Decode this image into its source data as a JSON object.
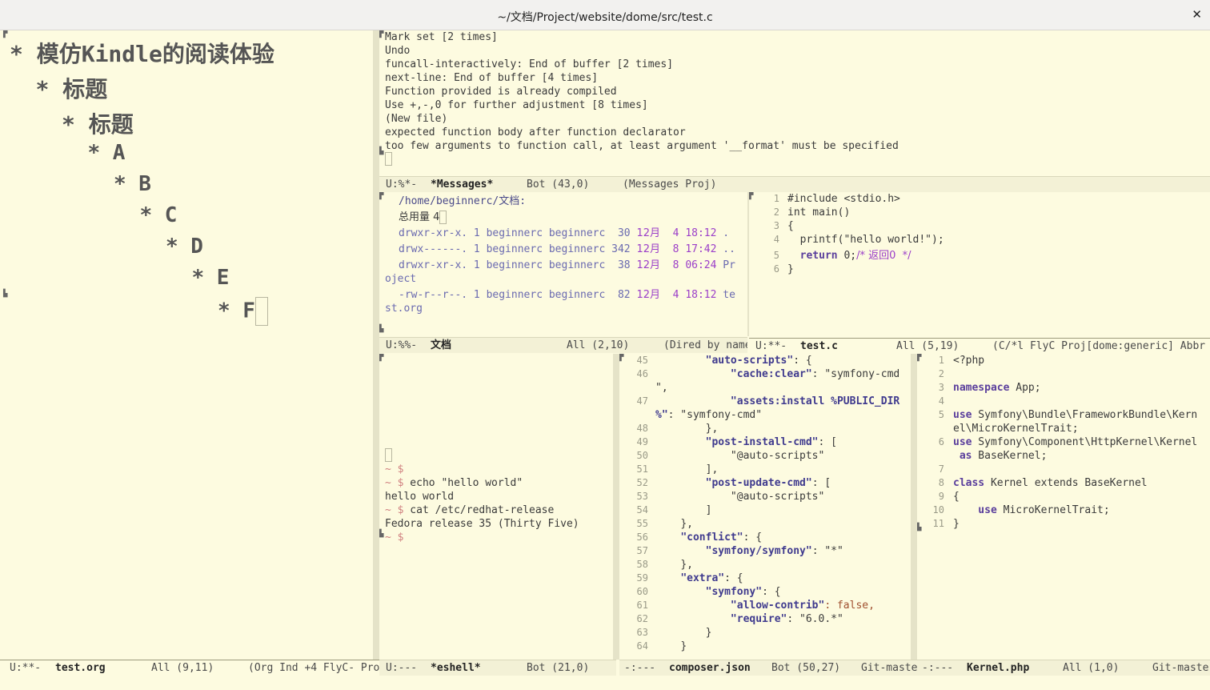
{
  "window": {
    "title": "~/文档/Project/website/dome/src/test.c",
    "close": "✕"
  },
  "org": {
    "headings": [
      {
        "text": "* 模仿Kindle的阅读体验",
        "level": 1
      },
      {
        "text": "* 标题",
        "level": 2
      },
      {
        "text": "* 标题",
        "level": 3
      },
      {
        "text": "* A",
        "level": 4
      },
      {
        "text": "* B",
        "level": 5
      },
      {
        "text": "* C",
        "level": 6
      },
      {
        "text": "* D",
        "level": 7
      },
      {
        "text": "* E",
        "level": 8
      },
      {
        "text": "* F",
        "level": 9
      }
    ],
    "modeline": {
      "state": "U:**-",
      "buffer": "test.org",
      "pos": "All (9,11)",
      "modes": "(Org Ind +4 FlyC- Pro"
    }
  },
  "messages": {
    "lines": [
      "Mark set [2 times]",
      "Undo",
      "funcall-interactively: End of buffer [2 times]",
      "next-line: End of buffer [4 times]",
      "Function provided is already compiled",
      "Use +,-,0 for further adjustment [8 times]",
      "(New file)",
      "expected function body after function declarator",
      "too few arguments to function call, at least argument '__format' must be specified"
    ],
    "modeline": {
      "state": "U:%*-",
      "buffer": "*Messages*",
      "pos": "Bot (43,0)",
      "modes": "(Messages Proj)"
    }
  },
  "dired": {
    "path": "/home/beginnerc/文档:",
    "total": "总用量 4",
    "entries": [
      {
        "perm": "drwxr-xr-x.",
        "links": "1",
        "owner": "beginnerc",
        "group": "beginnerc",
        "size": "30",
        "month": "12月",
        "day": "4",
        "time": "18:12",
        "name": "."
      },
      {
        "perm": "drwx------.",
        "links": "1",
        "owner": "beginnerc",
        "group": "beginnerc",
        "size": "342",
        "month": "12月",
        "day": "8",
        "time": "17:42",
        "name": ".."
      },
      {
        "perm": "drwxr-xr-x.",
        "links": "1",
        "owner": "beginnerc",
        "group": "beginnerc",
        "size": "38",
        "month": "12月",
        "day": "8",
        "time": "06:24",
        "name": "Pr",
        "wrap": "oject"
      },
      {
        "perm": "-rw-r--r--.",
        "links": "1",
        "owner": "beginnerc",
        "group": "beginnerc",
        "size": "82",
        "month": "12月",
        "day": "4",
        "time": "18:12",
        "name": "te",
        "wrap": "st.org"
      }
    ],
    "modeline": {
      "state": "U:%%-",
      "buffer": "文档",
      "pos": "All (2,10)",
      "modes": "(Dired by name"
    }
  },
  "testc": {
    "lines": [
      {
        "n": "1",
        "code": "#include <stdio.h>"
      },
      {
        "n": "2",
        "code": "int main()"
      },
      {
        "n": "3",
        "code": "{"
      },
      {
        "n": "4",
        "code": "  printf(\"hello world!\");"
      },
      {
        "n": "5",
        "code_kw": "return",
        "code_rest": " 0;",
        "code_comment": "/* 返回0  */"
      },
      {
        "n": "6",
        "code": "}"
      }
    ],
    "modeline": {
      "state": "U:**-",
      "buffer": "test.c",
      "pos": "All (5,19)",
      "modes": "(C/*l FlyC Proj[dome:generic] Abbr"
    }
  },
  "eshell": {
    "lines": [
      {
        "prompt": "~ $",
        "text": ""
      },
      {
        "prompt": "~ $",
        "text": " echo \"hello world\""
      },
      {
        "prompt": "",
        "text": "hello world"
      },
      {
        "prompt": "~ $",
        "text": " cat /etc/redhat-release"
      },
      {
        "prompt": "",
        "text": "Fedora release 35 (Thirty Five)"
      },
      {
        "prompt": "~ $",
        "text": ""
      }
    ],
    "modeline": {
      "state": "U:---",
      "buffer": "*eshell*",
      "pos": "Bot (21,0)"
    }
  },
  "composer": {
    "lines": [
      {
        "n": "45",
        "indent": "        ",
        "key": "\"auto-scripts\"",
        "rest": ": {"
      },
      {
        "n": "46",
        "indent": "            ",
        "key": "\"cache:clear\"",
        "rest": ": \"symfony-cmd"
      },
      {
        "n": "",
        "indent": "",
        "key": "",
        "rest": "\","
      },
      {
        "n": "47",
        "indent": "            ",
        "key": "\"assets:install %PUBLIC_DIR",
        "rest": ""
      },
      {
        "n": "",
        "indent": "",
        "key": "%\"",
        "rest": ": \"symfony-cmd\""
      },
      {
        "n": "48",
        "indent": "        ",
        "key": "",
        "rest": "},"
      },
      {
        "n": "49",
        "indent": "        ",
        "key": "\"post-install-cmd\"",
        "rest": ": ["
      },
      {
        "n": "50",
        "indent": "            ",
        "key": "",
        "rest": "\"@auto-scripts\""
      },
      {
        "n": "51",
        "indent": "        ",
        "key": "",
        "rest": "],"
      },
      {
        "n": "52",
        "indent": "        ",
        "key": "\"post-update-cmd\"",
        "rest": ": ["
      },
      {
        "n": "53",
        "indent": "            ",
        "key": "",
        "rest": "\"@auto-scripts\""
      },
      {
        "n": "54",
        "indent": "        ",
        "key": "",
        "rest": "]"
      },
      {
        "n": "55",
        "indent": "    ",
        "key": "",
        "rest": "},"
      },
      {
        "n": "56",
        "indent": "    ",
        "key": "\"conflict\"",
        "rest": ": {"
      },
      {
        "n": "57",
        "indent": "        ",
        "key": "\"symfony/symfony\"",
        "rest": ": \"*\""
      },
      {
        "n": "58",
        "indent": "    ",
        "key": "",
        "rest": "},"
      },
      {
        "n": "59",
        "indent": "    ",
        "key": "\"extra\"",
        "rest": ": {"
      },
      {
        "n": "60",
        "indent": "        ",
        "key": "\"symfony\"",
        "rest": ": {"
      },
      {
        "n": "61",
        "indent": "            ",
        "key": "\"allow-contrib\"",
        "rest": ": false,"
      },
      {
        "n": "62",
        "indent": "            ",
        "key": "\"require\"",
        "rest": ": \"6.0.*\""
      },
      {
        "n": "63",
        "indent": "        ",
        "key": "",
        "rest": "}"
      },
      {
        "n": "64",
        "indent": "    ",
        "key": "",
        "rest": "}"
      }
    ],
    "modeline": {
      "state": "-:---",
      "buffer": "composer.json",
      "pos": "Bot (50,27)",
      "modes": "Git-maste"
    }
  },
  "kernel": {
    "lines": [
      {
        "n": "1",
        "kw": "",
        "rest": "<?php"
      },
      {
        "n": "2",
        "kw": "",
        "rest": ""
      },
      {
        "n": "3",
        "kw": "namespace",
        "rest": " App;"
      },
      {
        "n": "4",
        "kw": "",
        "rest": ""
      },
      {
        "n": "5",
        "kw": "use",
        "rest": " Symfony\\Bundle\\FrameworkBundle\\Kern"
      },
      {
        "n": "",
        "kw": "",
        "rest": "el\\MicroKernelTrait;"
      },
      {
        "n": "6",
        "kw": "use",
        "rest": " Symfony\\Component\\HttpKernel\\Kernel"
      },
      {
        "n": "",
        "kw": " as",
        "rest": " BaseKernel;"
      },
      {
        "n": "7",
        "kw": "",
        "rest": ""
      },
      {
        "n": "8",
        "kw": "class",
        "rest": " Kernel extends BaseKernel"
      },
      {
        "n": "9",
        "kw": "",
        "rest": "{"
      },
      {
        "n": "10",
        "kw": "    use",
        "rest": " MicroKernelTrait;"
      },
      {
        "n": "11",
        "kw": "",
        "rest": "}"
      }
    ],
    "modeline": {
      "state": "-:---",
      "buffer": "Kernel.php",
      "pos": "All (1,0)",
      "modes": "Git-maste"
    }
  }
}
